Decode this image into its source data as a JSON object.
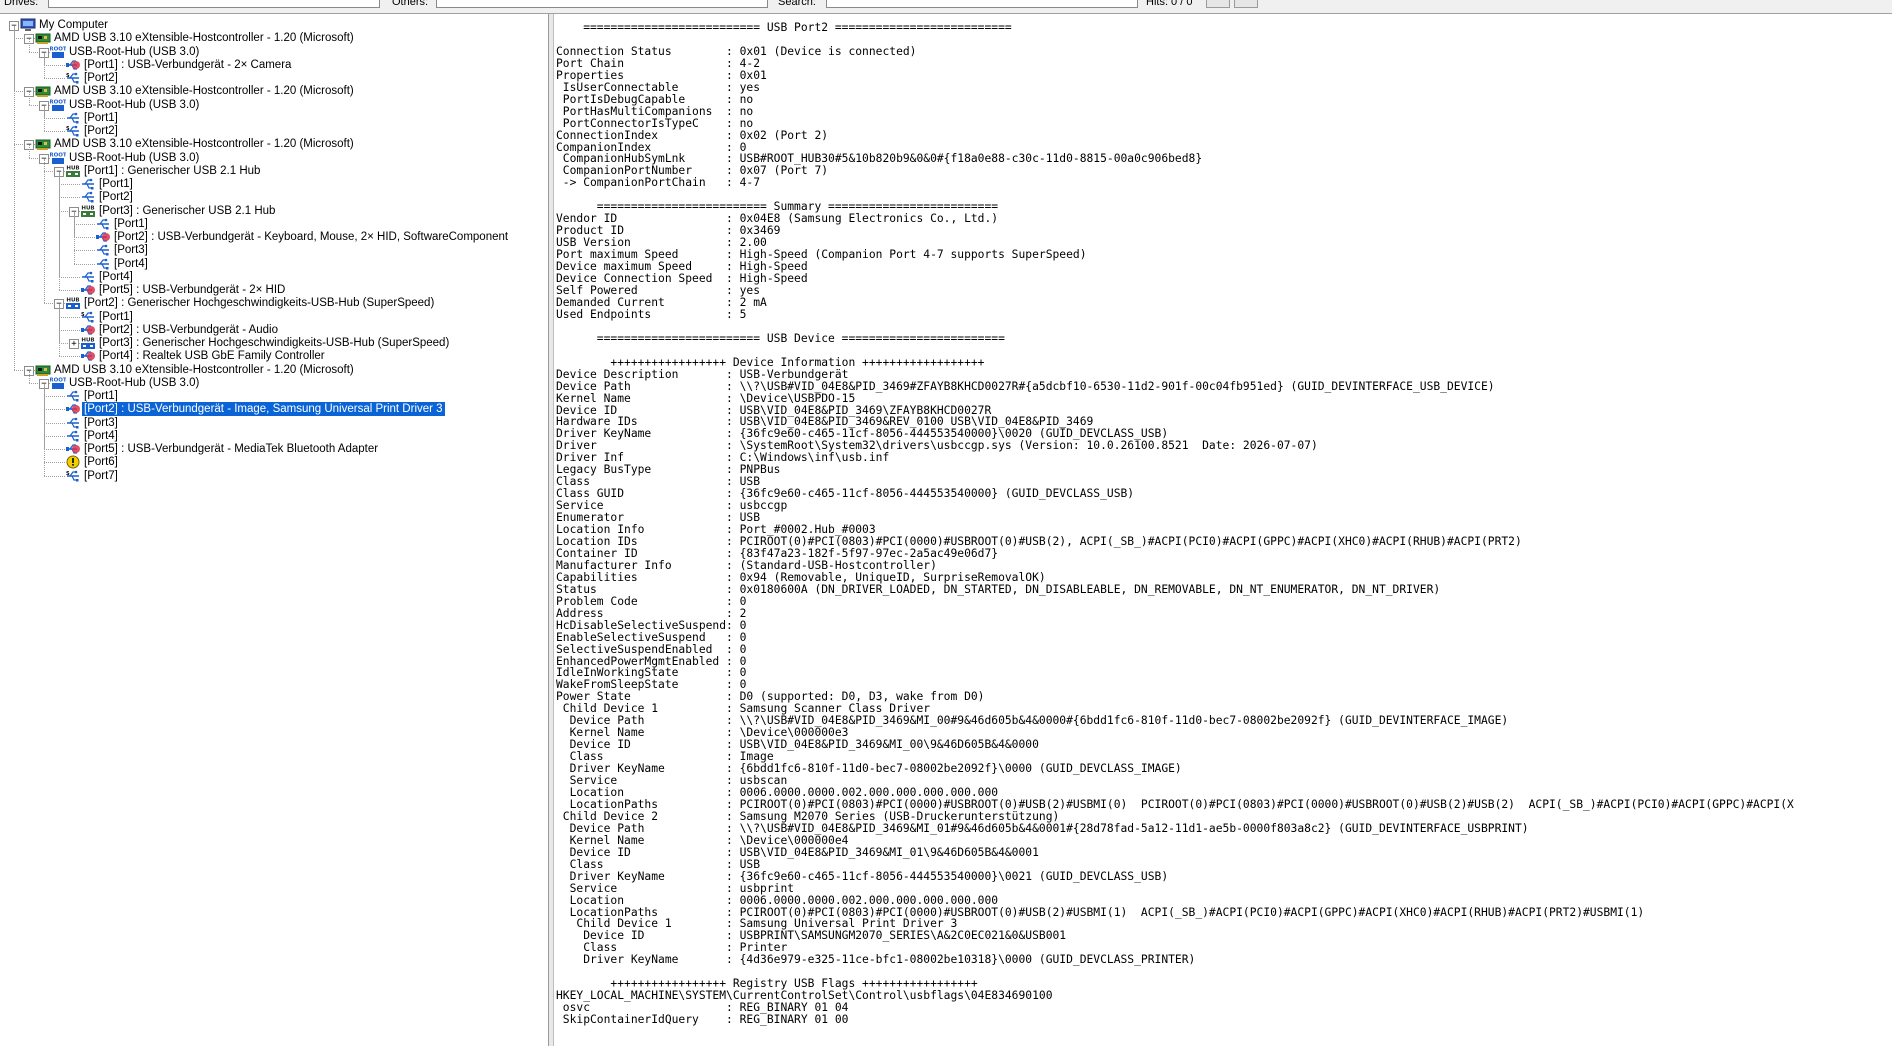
{
  "toolbar": {
    "drives_label": "Drives:",
    "others_label": "Others:",
    "search_label": "Search:",
    "hits_label": "Hits: 0 / 0"
  },
  "tree": [
    {
      "level": 0,
      "icon": "computer-icon",
      "label": "My Computer",
      "expanded": true
    },
    {
      "level": 1,
      "icon": "pci-card-icon",
      "label": "AMD USB 3.10 eXtensible-Hostcontroller - 1.20 (Microsoft)",
      "expanded": true
    },
    {
      "level": 2,
      "icon": "root-hub-icon",
      "label": "USB-Root-Hub (USB 3.0)",
      "expanded": true
    },
    {
      "level": 3,
      "icon": "usb-device-icon",
      "label": "[Port1] : USB-Verbundgerät - 2× Camera"
    },
    {
      "level": 3,
      "icon": "usb-port-ss-icon",
      "label": "[Port2]"
    },
    {
      "level": 1,
      "icon": "pci-card-icon",
      "label": "AMD USB 3.10 eXtensible-Hostcontroller - 1.20 (Microsoft)",
      "expanded": true
    },
    {
      "level": 2,
      "icon": "root-hub-icon",
      "label": "USB-Root-Hub (USB 3.0)",
      "expanded": true
    },
    {
      "level": 3,
      "icon": "usb-port-icon",
      "label": "[Port1]"
    },
    {
      "level": 3,
      "icon": "usb-port-ss-icon",
      "label": "[Port2]"
    },
    {
      "level": 1,
      "icon": "pci-card-icon",
      "label": "AMD USB 3.10 eXtensible-Hostcontroller - 1.20 (Microsoft)",
      "expanded": true
    },
    {
      "level": 2,
      "icon": "root-hub-icon",
      "label": "USB-Root-Hub (USB 3.0)",
      "expanded": true
    },
    {
      "level": 3,
      "icon": "hub-icon",
      "label": "[Port1] : Generischer USB 2.1 Hub",
      "expanded": true
    },
    {
      "level": 4,
      "icon": "usb-port-icon",
      "label": "[Port1]"
    },
    {
      "level": 4,
      "icon": "usb-port-icon",
      "label": "[Port2]"
    },
    {
      "level": 4,
      "icon": "hub-icon",
      "label": "[Port3] : Generischer USB 2.1 Hub",
      "expanded": true
    },
    {
      "level": 5,
      "icon": "usb-port-icon",
      "label": "[Port1]"
    },
    {
      "level": 5,
      "icon": "usb-device-icon",
      "label": "[Port2] : USB-Verbundgerät - Keyboard, Mouse, 2× HID, SoftwareComponent"
    },
    {
      "level": 5,
      "icon": "usb-port-icon",
      "label": "[Port3]"
    },
    {
      "level": 5,
      "icon": "usb-port-icon",
      "label": "[Port4]"
    },
    {
      "level": 4,
      "icon": "usb-port-icon",
      "label": "[Port4]"
    },
    {
      "level": 4,
      "icon": "usb-device-icon",
      "label": "[Port5] : USB-Verbundgerät - 2× HID"
    },
    {
      "level": 3,
      "icon": "hub-ss-icon",
      "label": "[Port2] : Generischer Hochgeschwindigkeits-USB-Hub (SuperSpeed)",
      "expanded": true
    },
    {
      "level": 4,
      "icon": "usb-port-ss-icon",
      "label": "[Port1]"
    },
    {
      "level": 4,
      "icon": "usb-device-icon",
      "label": "[Port2] : USB-Verbundgerät - Audio"
    },
    {
      "level": 4,
      "icon": "hub-ss-icon",
      "label": "[Port3] : Generischer Hochgeschwindigkeits-USB-Hub (SuperSpeed)",
      "collapsed": true
    },
    {
      "level": 4,
      "icon": "usb-device-icon",
      "label": "[Port4] : Realtek USB GbE Family Controller"
    },
    {
      "level": 1,
      "icon": "pci-card-icon",
      "label": "AMD USB 3.10 eXtensible-Hostcontroller - 1.20 (Microsoft)",
      "expanded": true
    },
    {
      "level": 2,
      "icon": "root-hub-icon",
      "label": "USB-Root-Hub (USB 3.0)",
      "expanded": true
    },
    {
      "level": 3,
      "icon": "usb-port-icon",
      "label": "[Port1]"
    },
    {
      "level": 3,
      "icon": "usb-device-icon",
      "label": "[Port2] : USB-Verbundgerät - Image, Samsung Universal Print Driver 3",
      "selected": true
    },
    {
      "level": 3,
      "icon": "usb-port-icon",
      "label": "[Port3]"
    },
    {
      "level": 3,
      "icon": "usb-port-icon",
      "label": "[Port4]"
    },
    {
      "level": 3,
      "icon": "usb-device-icon",
      "label": "[Port5] : USB-Verbundgerät - MediaTek Bluetooth Adapter"
    },
    {
      "level": 3,
      "icon": "warning-icon",
      "label": "[Port6]"
    },
    {
      "level": 3,
      "icon": "usb-port-ss-icon",
      "label": "[Port7]"
    }
  ],
  "details_lines": [
    "    ========================== USB Port2 ==========================",
    "",
    "Connection Status        : 0x01 (Device is connected)",
    "Port Chain               : 4-2",
    "Properties               : 0x01",
    " IsUserConnectable       : yes",
    " PortIsDebugCapable      : no",
    " PortHasMultiCompanions  : no",
    " PortConnectorIsTypeC    : no",
    "ConnectionIndex          : 0x02 (Port 2)",
    "CompanionIndex           : 0",
    " CompanionHubSymLnk      : USB#ROOT_HUB30#5&10b820b9&0&0#{f18a0e88-c30c-11d0-8815-00a0c906bed8}",
    " CompanionPortNumber     : 0x07 (Port 7)",
    " -> CompanionPortChain   : 4-7",
    "",
    "      ========================= Summary =========================",
    "Vendor ID                : 0x04E8 (Samsung Electronics Co., Ltd.)",
    "Product ID               : 0x3469",
    "USB Version              : 2.00",
    "Port maximum Speed       : High-Speed (Companion Port 4-7 supports SuperSpeed)",
    "Device maximum Speed     : High-Speed",
    "Device Connection Speed  : High-Speed",
    "Self Powered             : yes",
    "Demanded Current         : 2 mA",
    "Used Endpoints           : 5",
    "",
    "      ======================== USB Device ========================",
    "",
    "        +++++++++++++++++ Device Information ++++++++++++++++++",
    "Device Description       : USB-Verbundgerät",
    "Device Path              : \\\\?\\USB#VID_04E8&PID_3469#ZFAYB8KHCD0027R#{a5dcbf10-6530-11d2-901f-00c04fb951ed} (GUID_DEVINTERFACE_USB_DEVICE)",
    "Kernel Name              : \\Device\\USBPDO-15",
    "Device ID                : USB\\VID_04E8&PID_3469\\ZFAYB8KHCD0027R",
    "Hardware IDs             : USB\\VID_04E8&PID_3469&REV_0100 USB\\VID_04E8&PID_3469",
    "Driver KeyName           : {36fc9e60-c465-11cf-8056-444553540000}\\0020 (GUID_DEVCLASS_USB)",
    "Driver                   : \\SystemRoot\\System32\\drivers\\usbccgp.sys (Version: 10.0.26100.8521  Date: 2026-07-07)",
    "Driver Inf               : C:\\Windows\\inf\\usb.inf",
    "Legacy BusType           : PNPBus",
    "Class                    : USB",
    "Class GUID               : {36fc9e60-c465-11cf-8056-444553540000} (GUID_DEVCLASS_USB)",
    "Service                  : usbccgp",
    "Enumerator               : USB",
    "Location Info            : Port_#0002.Hub_#0003",
    "Location IDs             : PCIROOT(0)#PCI(0803)#PCI(0000)#USBROOT(0)#USB(2), ACPI(_SB_)#ACPI(PCI0)#ACPI(GPPC)#ACPI(XHC0)#ACPI(RHUB)#ACPI(PRT2)",
    "Container ID             : {83f47a23-182f-5f97-97ec-2a5ac49e06d7}",
    "Manufacturer Info        : (Standard-USB-Hostcontroller)",
    "Capabilities             : 0x94 (Removable, UniqueID, SurpriseRemovalOK)",
    "Status                   : 0x0180600A (DN_DRIVER_LOADED, DN_STARTED, DN_DISABLEABLE, DN_REMOVABLE, DN_NT_ENUMERATOR, DN_NT_DRIVER)",
    "Problem Code             : 0",
    "Address                  : 2",
    "HcDisableSelectiveSuspend: 0",
    "EnableSelectiveSuspend   : 0",
    "SelectiveSuspendEnabled  : 0",
    "EnhancedPowerMgmtEnabled : 0",
    "IdleInWorkingState       : 0",
    "WakeFromSleepState       : 0",
    "Power State              : D0 (supported: D0, D3, wake from D0)",
    " Child Device 1          : Samsung Scanner Class Driver",
    "  Device Path            : \\\\?\\USB#VID_04E8&PID_3469&MI_00#9&46d605b&4&0000#{6bdd1fc6-810f-11d0-bec7-08002be2092f} (GUID_DEVINTERFACE_IMAGE)",
    "  Kernel Name            : \\Device\\000000e3",
    "  Device ID              : USB\\VID_04E8&PID_3469&MI_00\\9&46D605B&4&0000",
    "  Class                  : Image",
    "  Driver KeyName         : {6bdd1fc6-810f-11d0-bec7-08002be2092f}\\0000 (GUID_DEVCLASS_IMAGE)",
    "  Service                : usbscan",
    "  Location               : 0006.0000.0000.002.000.000.000.000.000",
    "  LocationPaths          : PCIROOT(0)#PCI(0803)#PCI(0000)#USBROOT(0)#USB(2)#USBMI(0)  PCIROOT(0)#PCI(0803)#PCI(0000)#USBROOT(0)#USB(2)#USB(2)  ACPI(_SB_)#ACPI(PCI0)#ACPI(GPPC)#ACPI(X",
    " Child Device 2          : Samsung M2070 Series (USB-Druckerunterstützung)",
    "  Device Path            : \\\\?\\USB#VID_04E8&PID_3469&MI_01#9&46d605b&4&0001#{28d78fad-5a12-11d1-ae5b-0000f803a8c2} (GUID_DEVINTERFACE_USBPRINT)",
    "  Kernel Name            : \\Device\\000000e4",
    "  Device ID              : USB\\VID_04E8&PID_3469&MI_01\\9&46D605B&4&0001",
    "  Class                  : USB",
    "  Driver KeyName         : {36fc9e60-c465-11cf-8056-444553540000}\\0021 (GUID_DEVCLASS_USB)",
    "  Service                : usbprint",
    "  Location               : 0006.0000.0000.002.000.000.000.000.000",
    "  LocationPaths          : PCIROOT(0)#PCI(0803)#PCI(0000)#USBROOT(0)#USB(2)#USBMI(1)  ACPI(_SB_)#ACPI(PCI0)#ACPI(GPPC)#ACPI(XHC0)#ACPI(RHUB)#ACPI(PRT2)#USBMI(1)",
    "   Child Device 1        : Samsung Universal Print Driver 3",
    "    Device ID            : USBPRINT\\SAMSUNGM2070_SERIES\\A&2C0EC021&0&USB001",
    "    Class                : Printer",
    "    Driver KeyName       : {4d36e979-e325-11ce-bfc1-08002be10318}\\0000 (GUID_DEVCLASS_PRINTER)",
    "",
    "        +++++++++++++++++ Registry USB Flags +++++++++++++++++",
    "HKEY_LOCAL_MACHINE\\SYSTEM\\CurrentControlSet\\Control\\usbflags\\04E834690100",
    " osvc                    : REG_BINARY 01 04",
    " SkipContainerIdQuery    : REG_BINARY 01 00"
  ],
  "colors": {
    "selection": "#0a64d6",
    "tree_line": "#a0a0a0",
    "port_blue": "#1a5fd0",
    "warning": "#f2d000",
    "pci_green": "#2e8b3a"
  }
}
